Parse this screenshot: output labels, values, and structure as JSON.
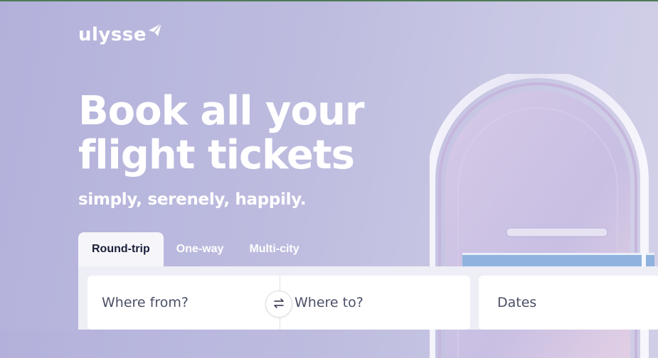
{
  "brand": {
    "name": "ulysse"
  },
  "hero": {
    "headline": "Book all your flight tickets",
    "tagline": "simply, serenely, happily."
  },
  "search": {
    "tabs": [
      {
        "label": "Round-trip",
        "active": true
      },
      {
        "label": "One-way",
        "active": false
      },
      {
        "label": "Multi-city",
        "active": false
      }
    ],
    "from_placeholder": "Where from?",
    "to_placeholder": "Where to?",
    "dates_placeholder": "Dates",
    "swap_icon": "swap-arrows-icon"
  },
  "icons": {
    "logo": "paper-plane-icon",
    "swap": "swap-arrows-icon"
  },
  "colors": {
    "background_start": "#b3b1db",
    "background_end": "#d3d1e8",
    "text_light": "#ffffff",
    "text_dark": "#1b1f3b",
    "field_text": "#4b4f66",
    "top_bar": "#4e7a55"
  }
}
